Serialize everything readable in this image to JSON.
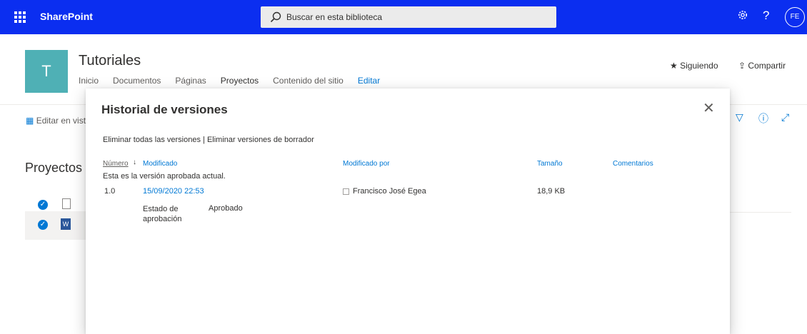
{
  "suite": {
    "brand": "SharePoint",
    "search_placeholder": "Buscar en esta biblioteca",
    "avatar_initials": "FE",
    "settings_icon": "gear-icon",
    "help_label": "?"
  },
  "site": {
    "logo_letter": "T",
    "title": "Tutoriales",
    "nav": [
      "Inicio",
      "Documentos",
      "Páginas",
      "Proyectos",
      "Contenido del sitio",
      "Editar"
    ],
    "follow_label": "Siguiendo",
    "share_label": "Compartir"
  },
  "commandbar": {
    "edit_grid_label": "Editar en vista de cuadrícula"
  },
  "library": {
    "title": "Proyectos"
  },
  "modal": {
    "title": "Historial de versiones",
    "delete_all": "Eliminar todas las versiones",
    "separator": "|",
    "delete_drafts": "Eliminar versiones de borrador",
    "columns": {
      "number": "Número",
      "modified": "Modificado",
      "modified_by": "Modificado por",
      "size": "Tamaño",
      "comments": "Comentarios"
    },
    "current_note": "Esta es la versión aprobada actual.",
    "version": {
      "number": "1.0",
      "modified": "15/09/2020 22:53",
      "modified_by": "Francisco José Egea",
      "size": "18,9 KB",
      "status_label": "Estado de aprobación",
      "status_value": "Aprobado"
    }
  },
  "colors": {
    "suite_bar": "#0b2ef0",
    "accent": "#0078d4",
    "site_logo": "#4fb0b5"
  }
}
